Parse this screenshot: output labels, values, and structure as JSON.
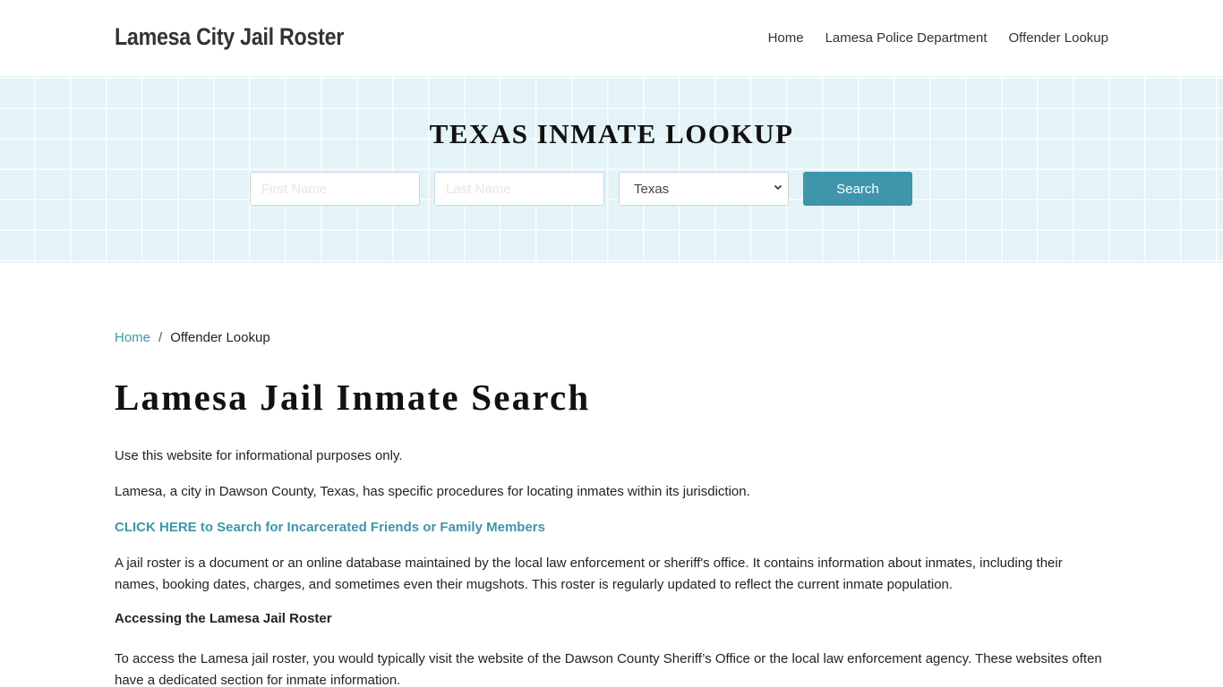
{
  "header": {
    "brand": "Lamesa City Jail Roster",
    "nav": [
      {
        "label": "Home"
      },
      {
        "label": "Lamesa Police Department"
      },
      {
        "label": "Offender Lookup"
      }
    ]
  },
  "hero": {
    "title": "TEXAS INMATE LOOKUP",
    "first_name_placeholder": "First Name",
    "last_name_placeholder": "Last Name",
    "state_selected": "Texas",
    "search_label": "Search"
  },
  "breadcrumb": {
    "home": "Home",
    "separator": "/",
    "current": "Offender Lookup"
  },
  "main": {
    "title": "Lamesa Jail Inmate Search",
    "paragraphs": [
      "Use this website for informational purposes only.",
      "Lamesa, a city in Dawson County, Texas, has specific procedures for locating inmates within its jurisdiction.",
      "CLICK HERE to Search for Incarcerated Friends or Family Members",
      "A jail roster is a document or an online database maintained by the local law enforcement or sheriff's office. It contains information about inmates, including their names, booking dates, charges, and sometimes even their mugshots. This roster is regularly updated to reflect the current inmate population.",
      "Accessing the Lamesa Jail Roster",
      "To access the Lamesa jail roster, you would typically visit the website of the Dawson County Sheriff’s Office or the local law enforcement agency. These websites often have a dedicated section for inmate information."
    ]
  },
  "colors": {
    "accent": "#3f95ab",
    "hero_bg": "#e3f3f7"
  }
}
